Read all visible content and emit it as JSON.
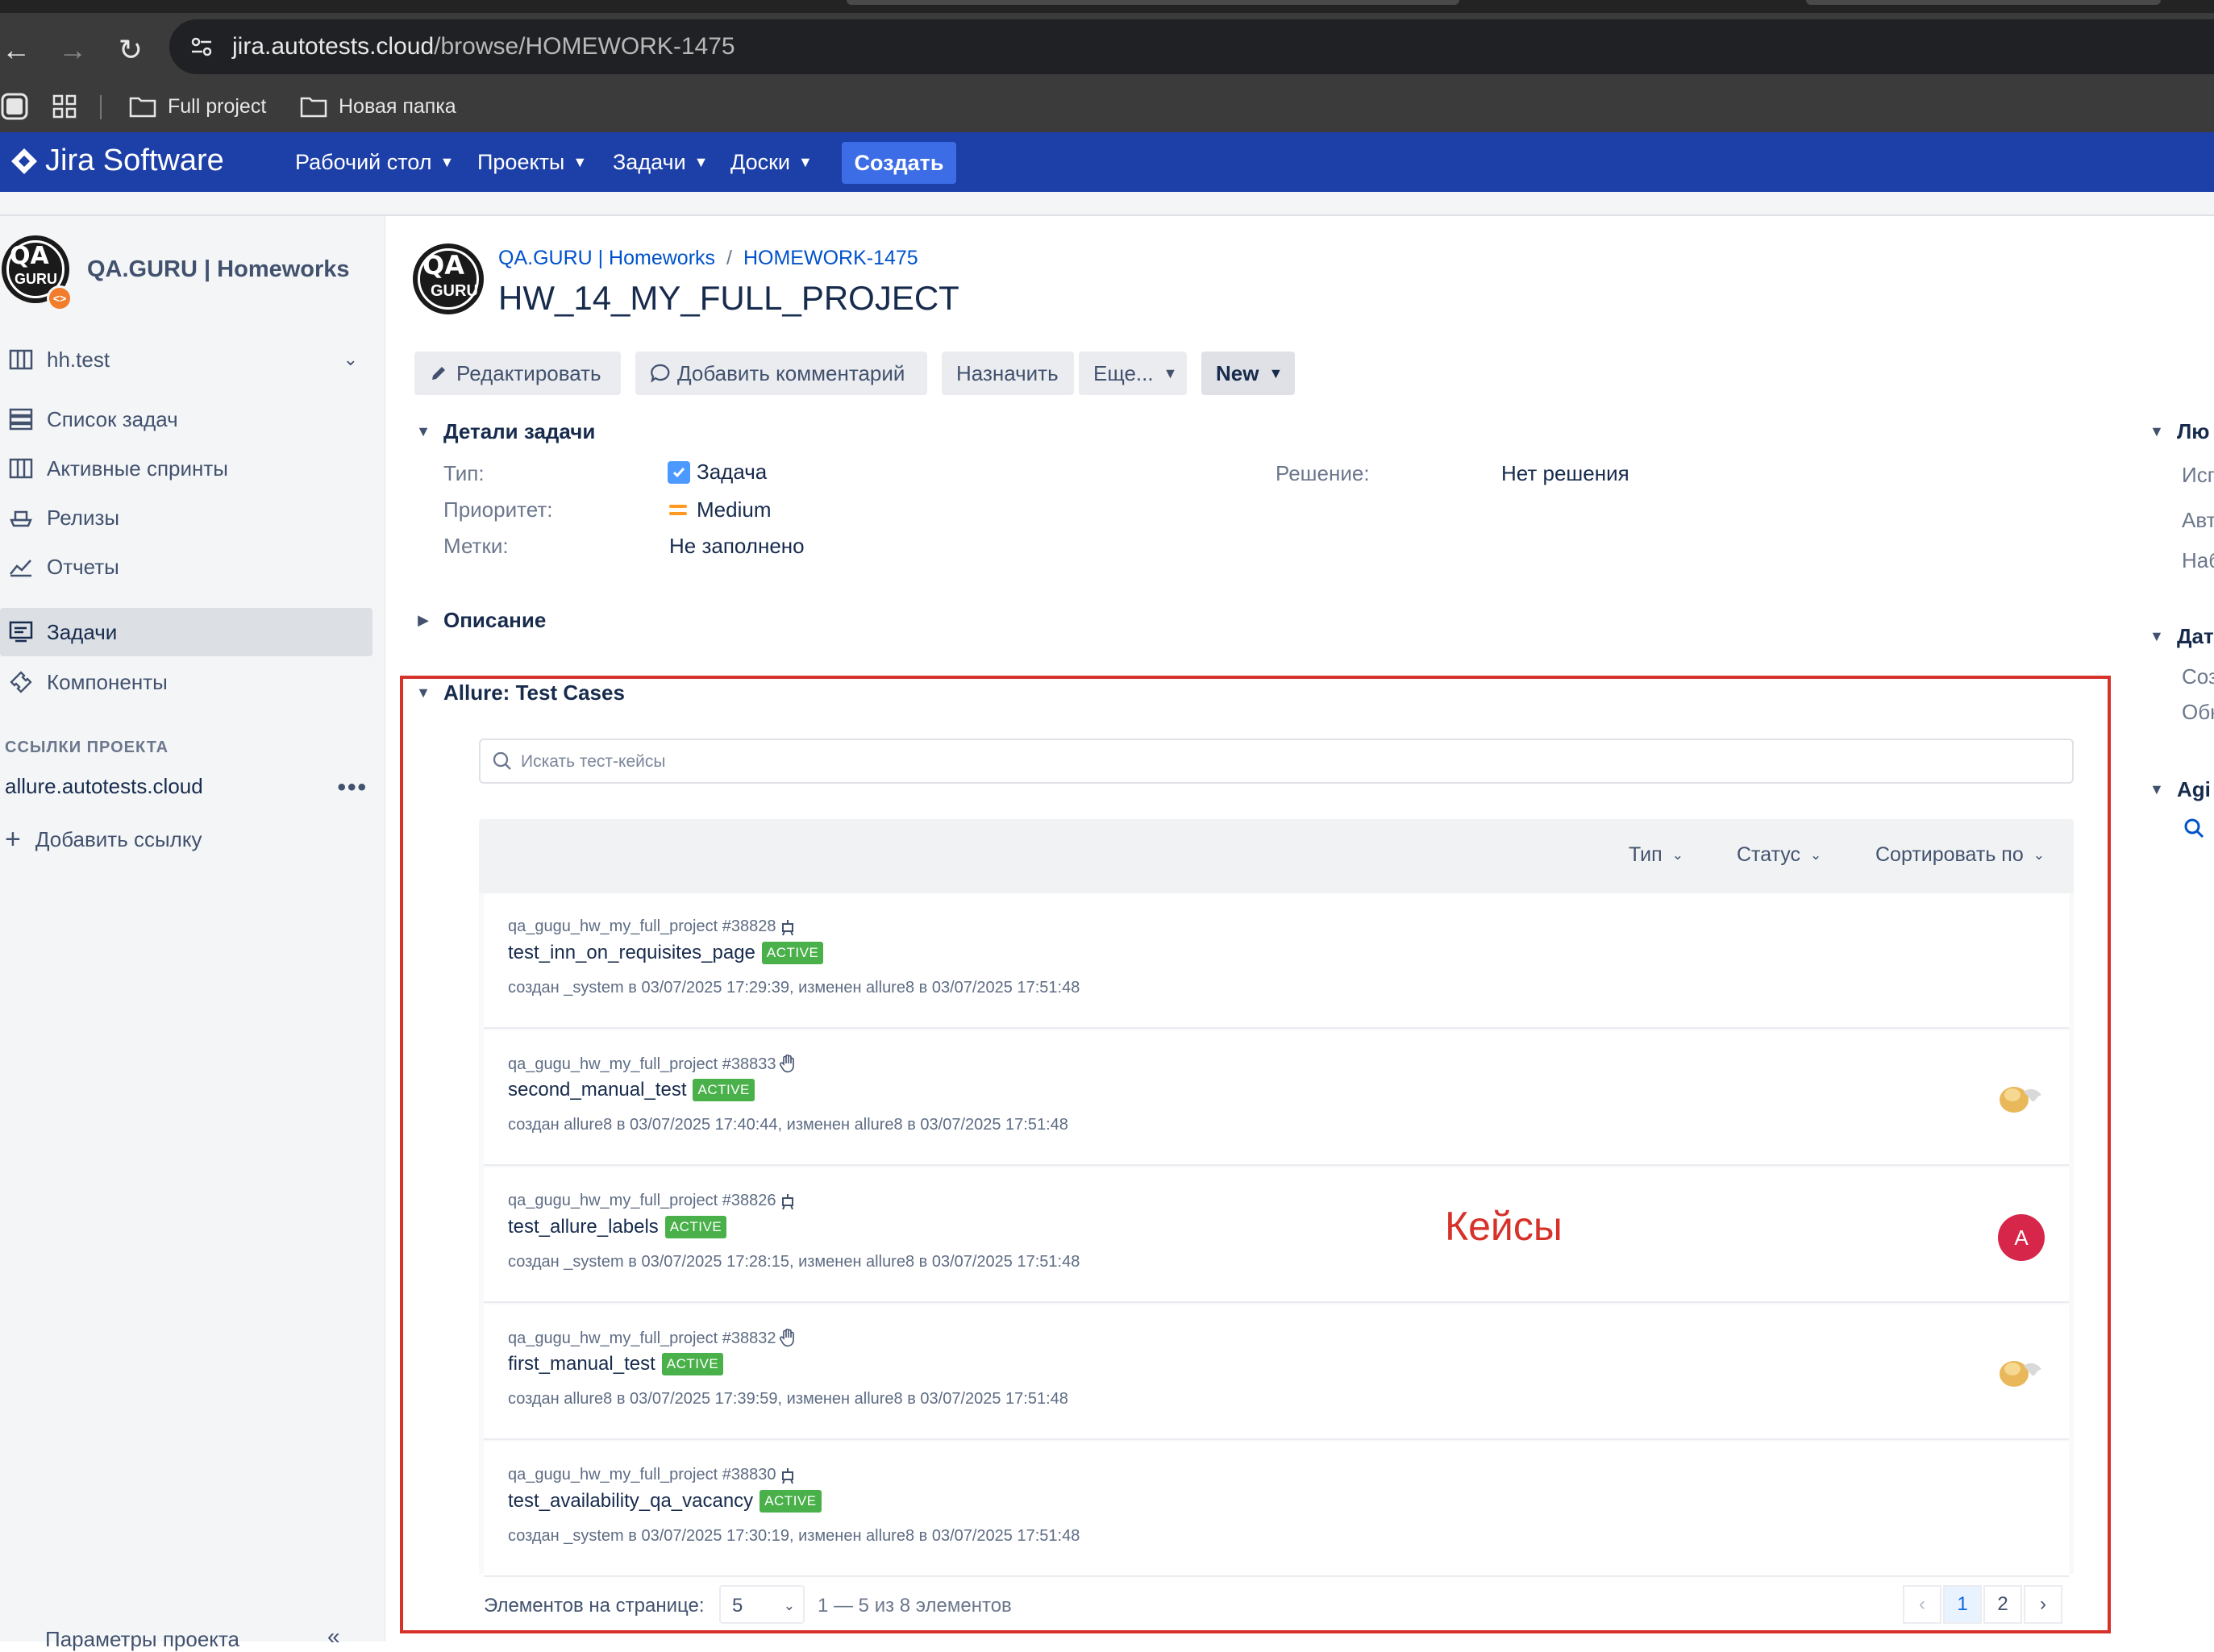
{
  "browser": {
    "url_host": "jira.autotests.cloud",
    "url_path": "/browse/HOMEWORK-1475",
    "bookmarks": [
      "Full project",
      "Новая папка"
    ]
  },
  "header": {
    "logo": "Jira Software",
    "menu": [
      "Рабочий стол",
      "Проекты",
      "Задачи",
      "Доски"
    ],
    "create": "Создать",
    "brand_color": "#1d3fa8"
  },
  "sidebar": {
    "project_name": "QA.GURU | Homeworks",
    "board": "hh.test",
    "items": [
      "Список задач",
      "Активные спринты",
      "Релизы",
      "Отчеты",
      "Задачи",
      "Компоненты"
    ],
    "section": "ССЫЛКИ ПРОЕКТА",
    "link": "allure.autotests.cloud",
    "add_link": "Добавить ссылку",
    "settings": "Параметры проекта"
  },
  "issue": {
    "breadcrumb_project": "QA.GURU | Homeworks",
    "breadcrumb_sep": "/",
    "breadcrumb_key": "HOMEWORK-1475",
    "title": "HW_14_MY_FULL_PROJECT",
    "ops": {
      "edit": "Редактировать",
      "comment": "Добавить комментарий",
      "assign": "Назначить",
      "more": "Еще...",
      "status": "New"
    },
    "details_title": "Детали задачи",
    "fields": {
      "type_label": "Тип:",
      "type_value": "Задача",
      "priority_label": "Приоритет:",
      "priority_value": "Medium",
      "labels_label": "Метки:",
      "labels_value": "Не заполнено",
      "resolution_label": "Решение:",
      "resolution_value": "Нет решения"
    },
    "description_title": "Описание"
  },
  "right_panel": {
    "heads": [
      "Лю",
      "Дат",
      "Agi"
    ],
    "lines": [
      "Исп",
      "Авт",
      "Наб",
      "Соз",
      "Обн"
    ]
  },
  "allure": {
    "title": "Allure: Test Cases",
    "search_placeholder": "Искать тест-кейсы",
    "filters": [
      "Тип",
      "Статус",
      "Сортировать по"
    ],
    "cases": [
      {
        "project": "qa_gugu_hw_my_full_project #38828",
        "kind": "automated",
        "name": "test_inn_on_requisites_page",
        "status": "ACTIVE",
        "meta": "создан _system в 03/07/2025 17:29:39, изменен allure8 в 03/07/2025 17:51:48",
        "avatar": ""
      },
      {
        "project": "qa_gugu_hw_my_full_project #38833",
        "kind": "manual",
        "name": "second_manual_test",
        "status": "ACTIVE",
        "meta": "создан allure8 в 03/07/2025 17:40:44, изменен allure8 в 03/07/2025 17:51:48",
        "avatar": "image"
      },
      {
        "project": "qa_gugu_hw_my_full_project #38826",
        "kind": "automated",
        "name": "test_allure_labels",
        "status": "ACTIVE",
        "meta": "создан _system в 03/07/2025 17:28:15, изменен allure8 в 03/07/2025 17:51:48",
        "avatar": "A"
      },
      {
        "project": "qa_gugu_hw_my_full_project #38832",
        "kind": "manual",
        "name": "first_manual_test",
        "status": "ACTIVE",
        "meta": "создан allure8 в 03/07/2025 17:39:59, изменен allure8 в 03/07/2025 17:51:48",
        "avatar": "image"
      },
      {
        "project": "qa_gugu_hw_my_full_project #38830",
        "kind": "automated",
        "name": "test_availability_qa_vacancy",
        "status": "ACTIVE",
        "meta": "создан _system в 03/07/2025 17:30:19, изменен allure8 в 03/07/2025 17:51:48",
        "avatar": ""
      }
    ],
    "annotation": "Кейсы",
    "pager": {
      "label": "Элементов на странице:",
      "per_page": "5",
      "range": "1 — 5 из 8 элементов",
      "pages": [
        "1",
        "2"
      ],
      "current": "1"
    }
  }
}
